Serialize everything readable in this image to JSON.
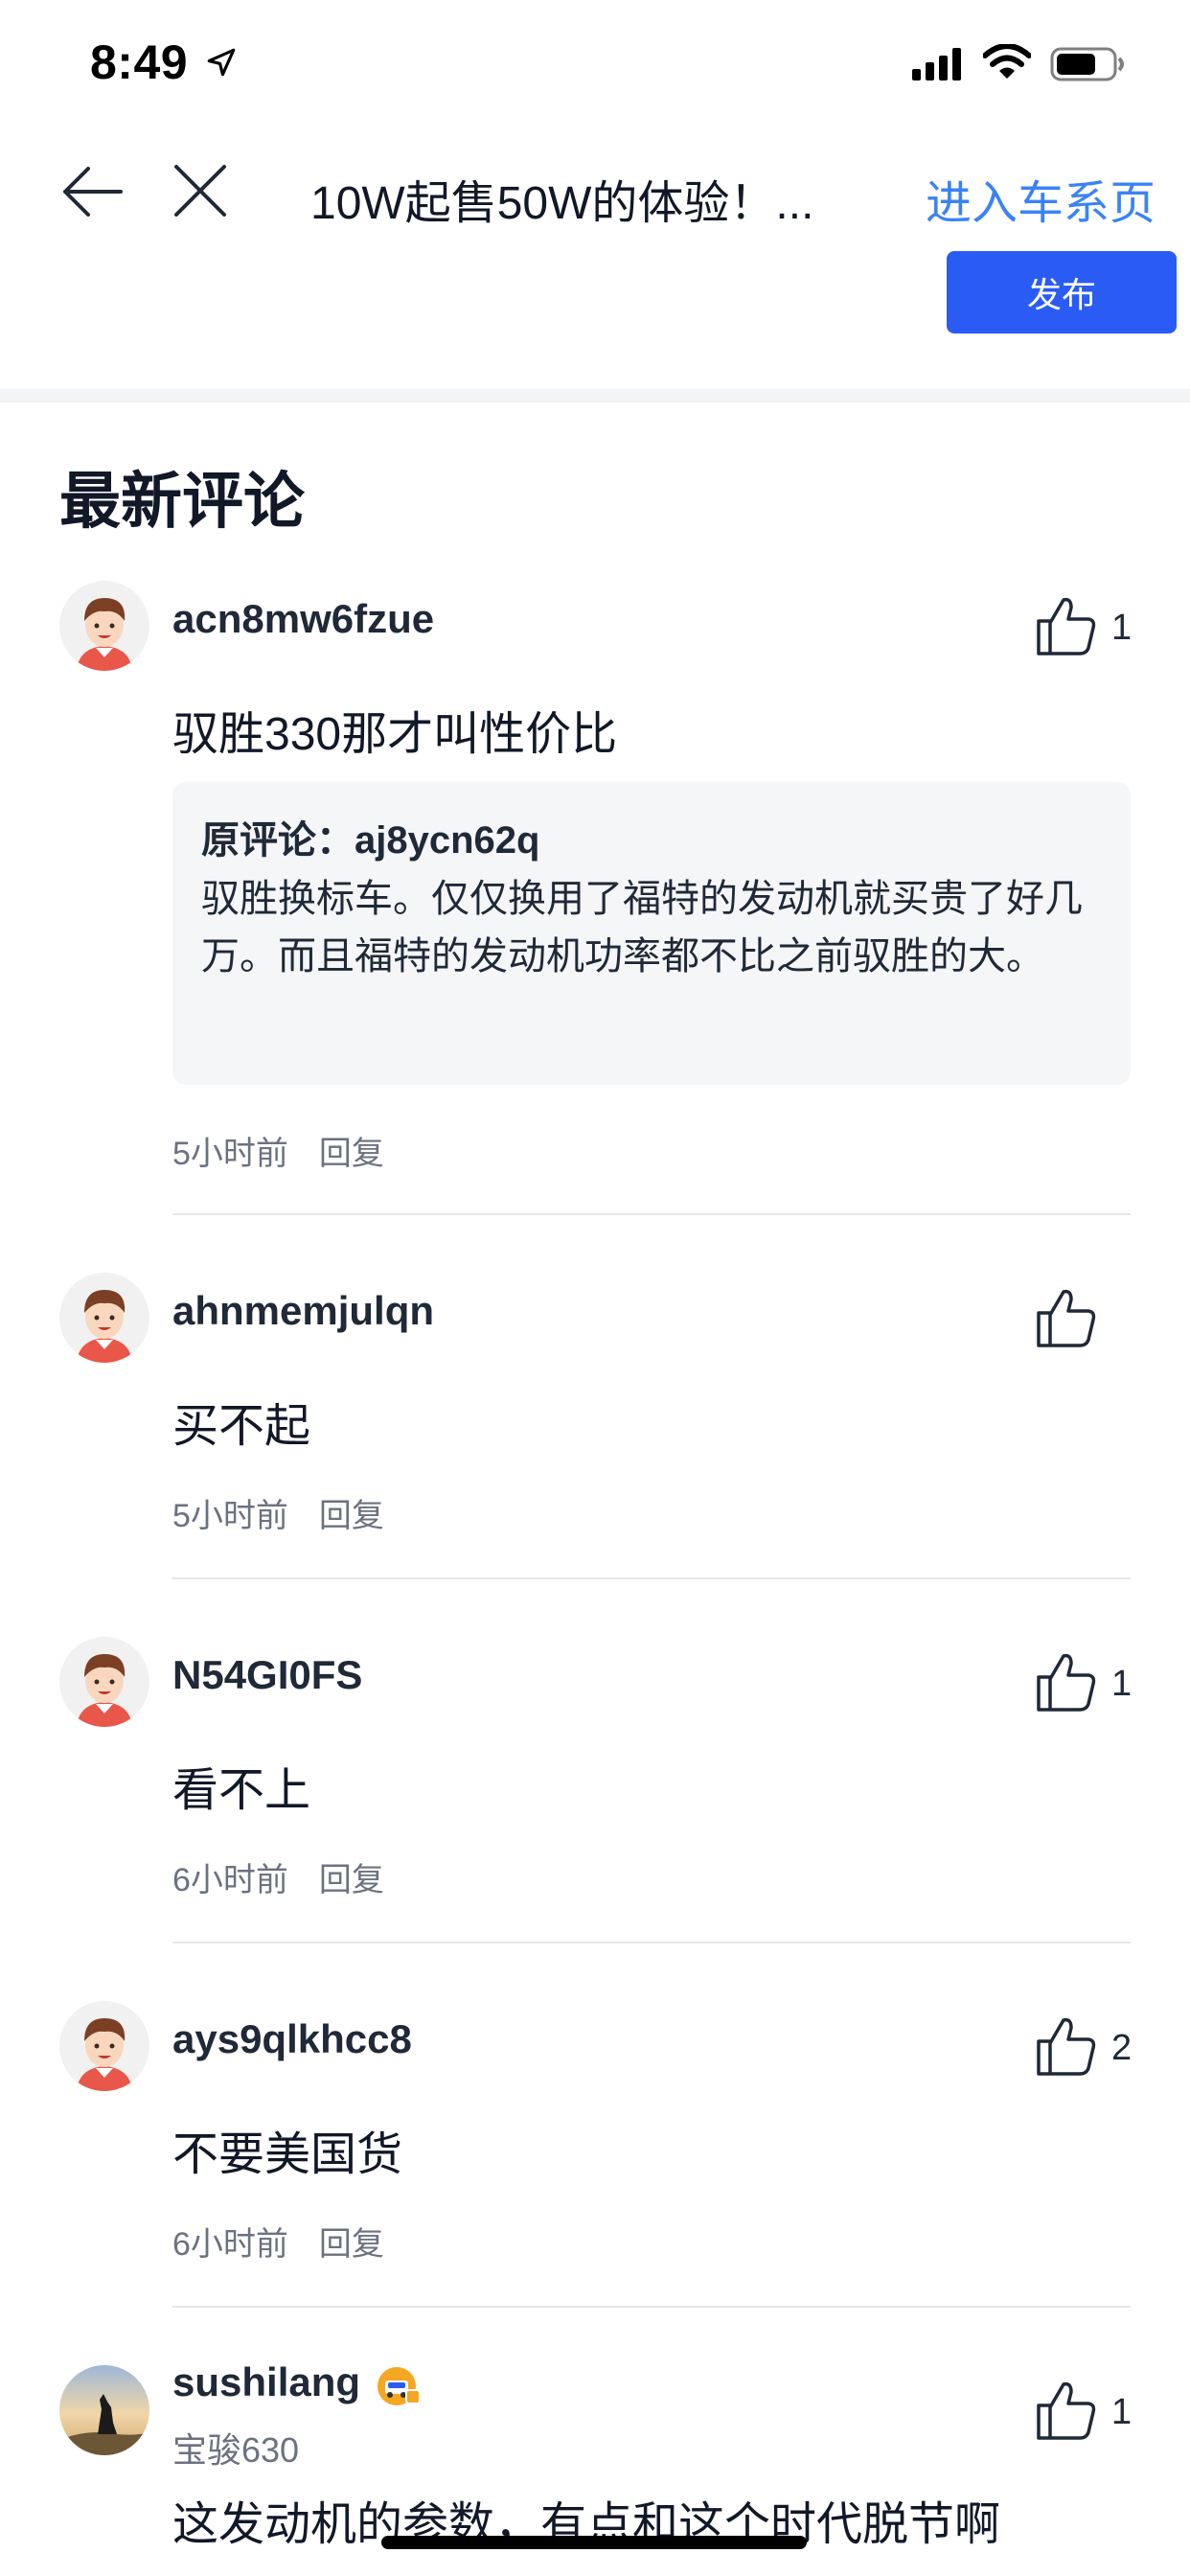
{
  "status_bar": {
    "time": "8:49"
  },
  "nav": {
    "title": "10W起售50W的体验！...",
    "car_series_link": "进入车系页"
  },
  "publish_button": "发布",
  "section_title": "最新评论",
  "comments": [
    {
      "username": "acn8mw6fzue",
      "likes": "1",
      "content": "驭胜330那才叫性价比",
      "quote": {
        "author": "原评论：aj8ycn62q",
        "text": "驭胜换标车。仅仅换用了福特的发动机就买贵了好几万。而且福特的发动机功率都不比之前驭胜的大。"
      },
      "time": "5小时前",
      "reply": "回复"
    },
    {
      "username": "ahnmemjulqn",
      "likes": "",
      "content": "买不起",
      "time": "5小时前",
      "reply": "回复"
    },
    {
      "username": "N54GI0FS",
      "likes": "1",
      "content": "看不上",
      "time": "6小时前",
      "reply": "回复"
    },
    {
      "username": "ays9qlkhcc8",
      "likes": "2",
      "content": "不要美国货",
      "time": "6小时前",
      "reply": "回复"
    },
    {
      "username": "sushilang",
      "car": "宝骏630",
      "likes": "1",
      "content": "这发动机的参数，有点和这个时代脱节啊"
    }
  ],
  "colors": {
    "accent": "#2a5cf5",
    "link": "#3b82f6"
  }
}
